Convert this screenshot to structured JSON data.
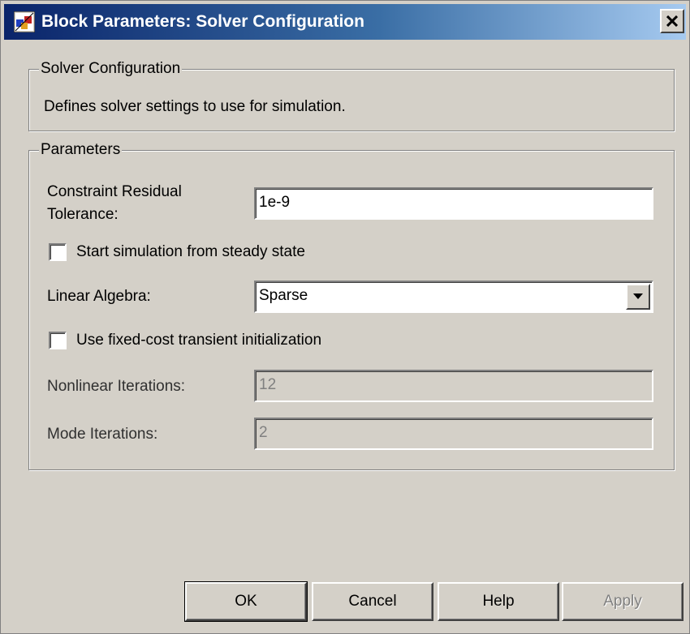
{
  "window": {
    "title": "Block Parameters: Solver Configuration",
    "close_glyph": "×"
  },
  "description_group": {
    "legend": "Solver Configuration",
    "text": "Defines solver settings to use for simulation."
  },
  "parameters_group": {
    "legend": "Parameters",
    "constraint_residual_tolerance": {
      "label_line1": "Constraint Residual",
      "label_line2": "Tolerance:",
      "value": "1e-9"
    },
    "start_from_steady_state": {
      "label": "Start simulation from steady state",
      "checked": false
    },
    "linear_algebra": {
      "label": "Linear Algebra:",
      "selected": "Sparse"
    },
    "fixed_cost_init": {
      "label": "Use fixed-cost transient initialization",
      "checked": false
    },
    "nonlinear_iterations": {
      "label": "Nonlinear Iterations:",
      "value": "12",
      "enabled": false
    },
    "mode_iterations": {
      "label": "Mode Iterations:",
      "value": "2",
      "enabled": false
    }
  },
  "buttons": {
    "ok": "OK",
    "cancel": "Cancel",
    "help": "Help",
    "apply": "Apply"
  },
  "colors": {
    "dialog_bg": "#d4d0c8",
    "titlebar_start": "#0a246a",
    "titlebar_end": "#a6caf0"
  }
}
